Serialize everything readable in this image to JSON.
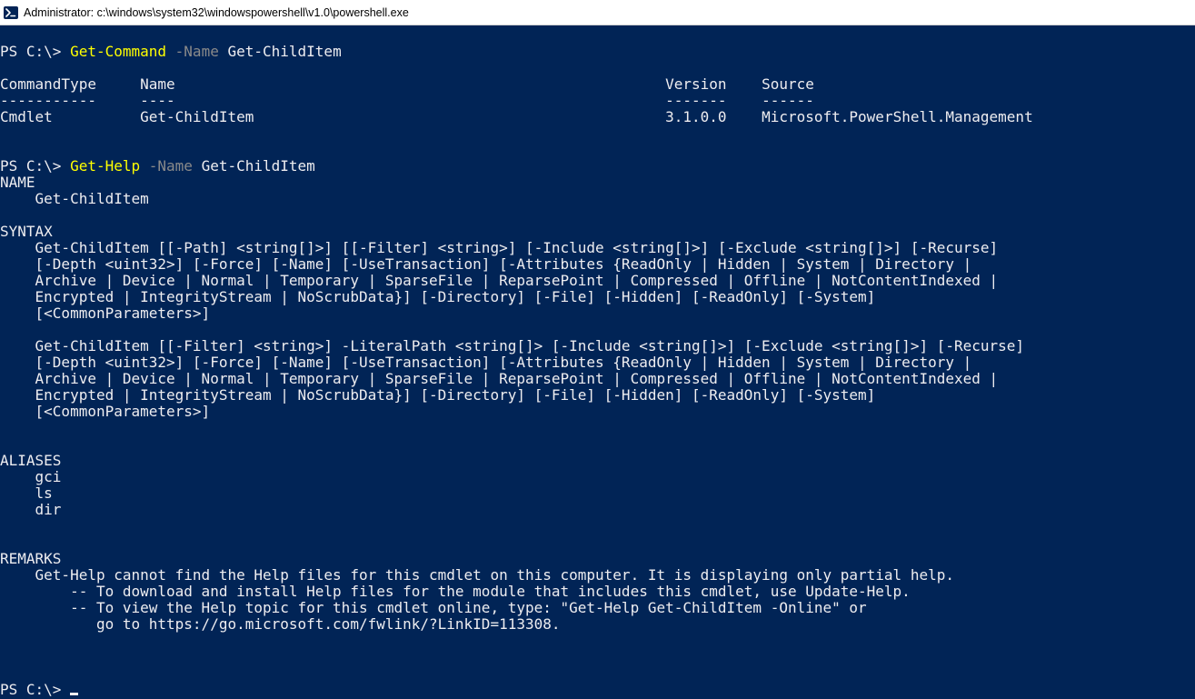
{
  "titlebar": {
    "text": "Administrator: c:\\windows\\system32\\windowspowershell\\v1.0\\powershell.exe"
  },
  "prompt": "PS C:\\> ",
  "commands": {
    "cmd1": {
      "cmdlet": "Get-Command",
      "param_flag": " -Name ",
      "arg": "Get-ChildItem"
    },
    "cmd2": {
      "cmdlet": "Get-Help",
      "param_flag": " -Name ",
      "arg": "Get-ChildItem"
    }
  },
  "table": {
    "hdr_commandtype": "CommandType",
    "hdr_name": "Name",
    "hdr_version": "Version",
    "hdr_source": "Source",
    "sep_commandtype": "-----------",
    "sep_name": "----",
    "sep_version": "-------",
    "sep_source": "------",
    "row_commandtype": "Cmdlet",
    "row_name": "Get-ChildItem",
    "row_version": "3.1.0.0",
    "row_source": "Microsoft.PowerShell.Management"
  },
  "help": {
    "name_hdr": "NAME",
    "name_val": "    Get-ChildItem",
    "syntax_hdr": "SYNTAX",
    "syntax1_l1": "    Get-ChildItem [[-Path] <string[]>] [[-Filter] <string>] [-Include <string[]>] [-Exclude <string[]>] [-Recurse]",
    "syntax1_l2": "    [-Depth <uint32>] [-Force] [-Name] [-UseTransaction] [-Attributes {ReadOnly | Hidden | System | Directory |",
    "syntax1_l3": "    Archive | Device | Normal | Temporary | SparseFile | ReparsePoint | Compressed | Offline | NotContentIndexed |",
    "syntax1_l4": "    Encrypted | IntegrityStream | NoScrubData}] [-Directory] [-File] [-Hidden] [-ReadOnly] [-System]",
    "syntax1_l5": "    [<CommonParameters>]",
    "syntax2_l1": "    Get-ChildItem [[-Filter] <string>] -LiteralPath <string[]> [-Include <string[]>] [-Exclude <string[]>] [-Recurse]",
    "syntax2_l2": "    [-Depth <uint32>] [-Force] [-Name] [-UseTransaction] [-Attributes {ReadOnly | Hidden | System | Directory |",
    "syntax2_l3": "    Archive | Device | Normal | Temporary | SparseFile | ReparsePoint | Compressed | Offline | NotContentIndexed |",
    "syntax2_l4": "    Encrypted | IntegrityStream | NoScrubData}] [-Directory] [-File] [-Hidden] [-ReadOnly] [-System]",
    "syntax2_l5": "    [<CommonParameters>]",
    "aliases_hdr": "ALIASES",
    "alias1": "    gci",
    "alias2": "    ls",
    "alias3": "    dir",
    "remarks_hdr": "REMARKS",
    "remarks_l1": "    Get-Help cannot find the Help files for this cmdlet on this computer. It is displaying only partial help.",
    "remarks_l2": "        -- To download and install Help files for the module that includes this cmdlet, use Update-Help.",
    "remarks_l3": "        -- To view the Help topic for this cmdlet online, type: \"Get-Help Get-ChildItem -Online\" or",
    "remarks_l4": "           go to https://go.microsoft.com/fwlink/?LinkID=113308."
  },
  "pad": {
    "col1": "     ",
    "col2": "             ",
    "col_to_version": "                                               ",
    "col_to_source": "    ",
    "row_col1_pad": "          ",
    "row_col2_pad": "    ",
    "row_to_version": "                                               ",
    "row_to_source": "    ",
    "sep_to_version": "                                                        ",
    "sep_to_source": "    ",
    "hdr_to_version": "                                                        ",
    "hdr_to_source": "    "
  }
}
